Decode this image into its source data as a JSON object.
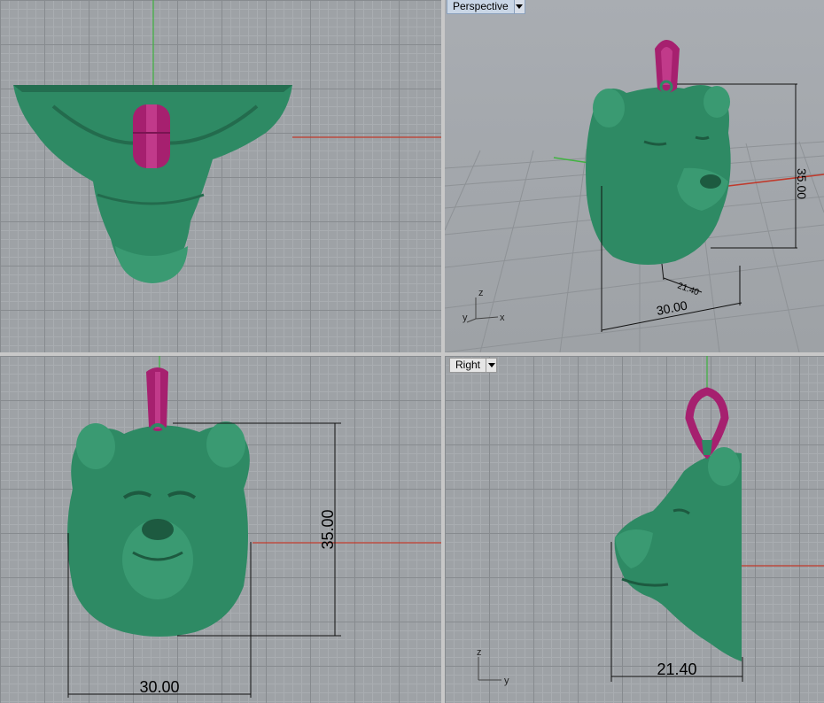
{
  "viewports": {
    "top": {
      "name": ""
    },
    "perspective": {
      "name": "Perspective",
      "dims": {
        "height": "35.00",
        "width": "30.00",
        "depth": "21.40"
      },
      "axes": {
        "x": "x",
        "y": "y",
        "z": "z"
      }
    },
    "front": {
      "name": "",
      "dims": {
        "height": "35.00",
        "width": "30.00"
      }
    },
    "right": {
      "name": "Right",
      "dims": {
        "depth": "21.40"
      },
      "axes": {
        "y": "y",
        "z": "z"
      }
    }
  },
  "colors": {
    "model": "#2e8a64",
    "bail": "#a6206f",
    "x_axis": "#c0392b",
    "y_axis": "#3fb33f",
    "grid": "#878b8f"
  }
}
